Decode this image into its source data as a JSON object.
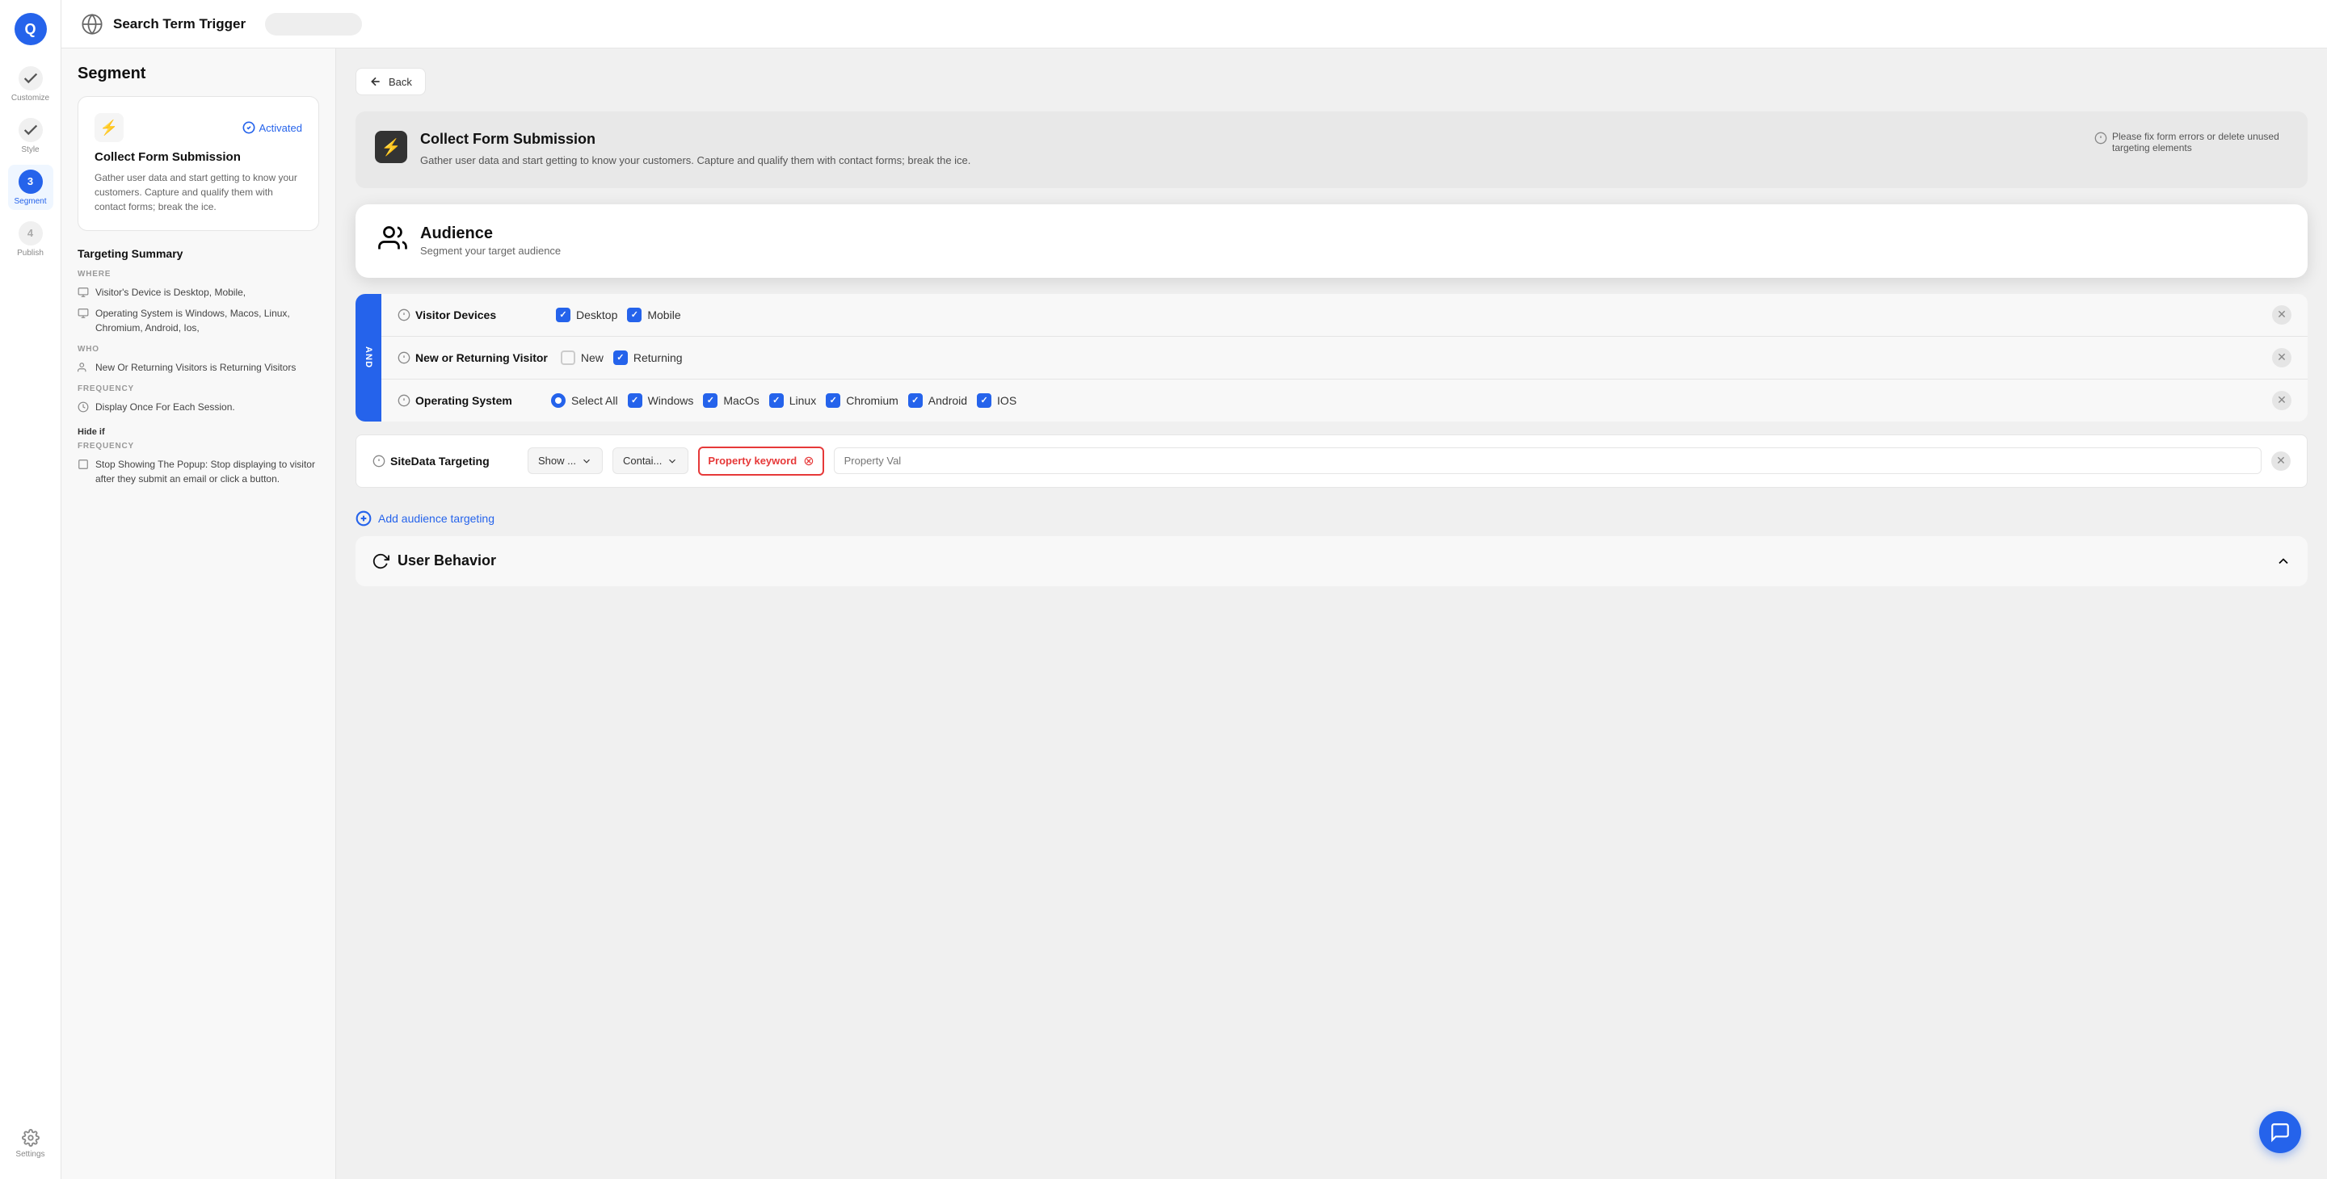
{
  "header": {
    "title": "Search Term Trigger",
    "globe_icon": "globe-icon"
  },
  "nav": {
    "logo": "Q",
    "items": [
      {
        "id": "customize",
        "label": "Customize",
        "step": null,
        "icon": "check-icon",
        "active": false
      },
      {
        "id": "style",
        "label": "Style",
        "step": null,
        "icon": "check-icon",
        "active": false
      },
      {
        "id": "segment",
        "label": "Segment",
        "step": "3",
        "icon": "circle-icon",
        "active": true
      },
      {
        "id": "publish",
        "label": "Publish",
        "step": "4",
        "icon": "circle-icon",
        "active": false
      },
      {
        "id": "settings",
        "label": "Settings",
        "step": null,
        "icon": "gear-icon",
        "active": false
      }
    ]
  },
  "sidebar": {
    "title": "Segment",
    "card": {
      "title": "Collect Form Submission",
      "description": "Gather user data and start getting to know your customers. Capture and qualify them with contact forms; break the ice.",
      "activated_label": "Activated"
    },
    "targeting_summary": {
      "title": "Targeting Summary",
      "where_label": "WHERE",
      "where_items": [
        "Visitor's Device is Desktop, Mobile,",
        "Operating System is Windows, Macos, Linux, Chromium, Android, Ios,"
      ],
      "who_label": "WHO",
      "who_items": [
        "New Or Returning Visitors is Returning Visitors"
      ],
      "frequency_label": "FREQUENCY",
      "frequency_items": [
        "Display Once For Each Session."
      ],
      "hide_if_label": "Hide if",
      "hide_frequency_label": "FREQUENCY",
      "hide_items": [
        "Stop Showing The Popup: Stop displaying to visitor after they submit an email or click a button."
      ]
    }
  },
  "main": {
    "back_button": "Back",
    "collect_form": {
      "title": "Collect Form Submission",
      "description": "Gather user data and start getting to know your customers. Capture and qualify them with contact forms; break the ice.",
      "warning": "Please fix form errors or delete unused targeting elements"
    },
    "audience": {
      "title": "Audience",
      "subtitle": "Segment your target audience"
    },
    "targeting_rows": [
      {
        "id": "visitor-devices",
        "label": "Visitor Devices",
        "options": [
          {
            "type": "checkbox",
            "label": "Desktop",
            "checked": true
          },
          {
            "type": "checkbox",
            "label": "Mobile",
            "checked": true
          }
        ]
      },
      {
        "id": "new-returning",
        "label": "New or Returning Visitor",
        "options": [
          {
            "type": "checkbox",
            "label": "New",
            "checked": false
          },
          {
            "type": "checkbox",
            "label": "Returning",
            "checked": true
          }
        ]
      },
      {
        "id": "operating-system",
        "label": "Operating System",
        "options": [
          {
            "type": "radio",
            "label": "Select All",
            "checked": true
          },
          {
            "type": "checkbox",
            "label": "Windows",
            "checked": true
          },
          {
            "type": "checkbox",
            "label": "MacOs",
            "checked": true
          },
          {
            "type": "checkbox",
            "label": "Linux",
            "checked": true
          },
          {
            "type": "checkbox",
            "label": "Chromium",
            "checked": true
          },
          {
            "type": "checkbox",
            "label": "Android",
            "checked": true
          },
          {
            "type": "checkbox",
            "label": "IOS",
            "checked": true
          }
        ]
      }
    ],
    "sitedata_row": {
      "label": "SiteData Targeting",
      "show_dropdown_value": "Show ...",
      "contains_dropdown_value": "Contai...",
      "property_keyword": "Property keyword",
      "property_val_placeholder": "Property Val"
    },
    "add_audience_label": "Add audience targeting",
    "user_behavior": {
      "title": "User Behavior"
    },
    "and_label": "AND"
  }
}
